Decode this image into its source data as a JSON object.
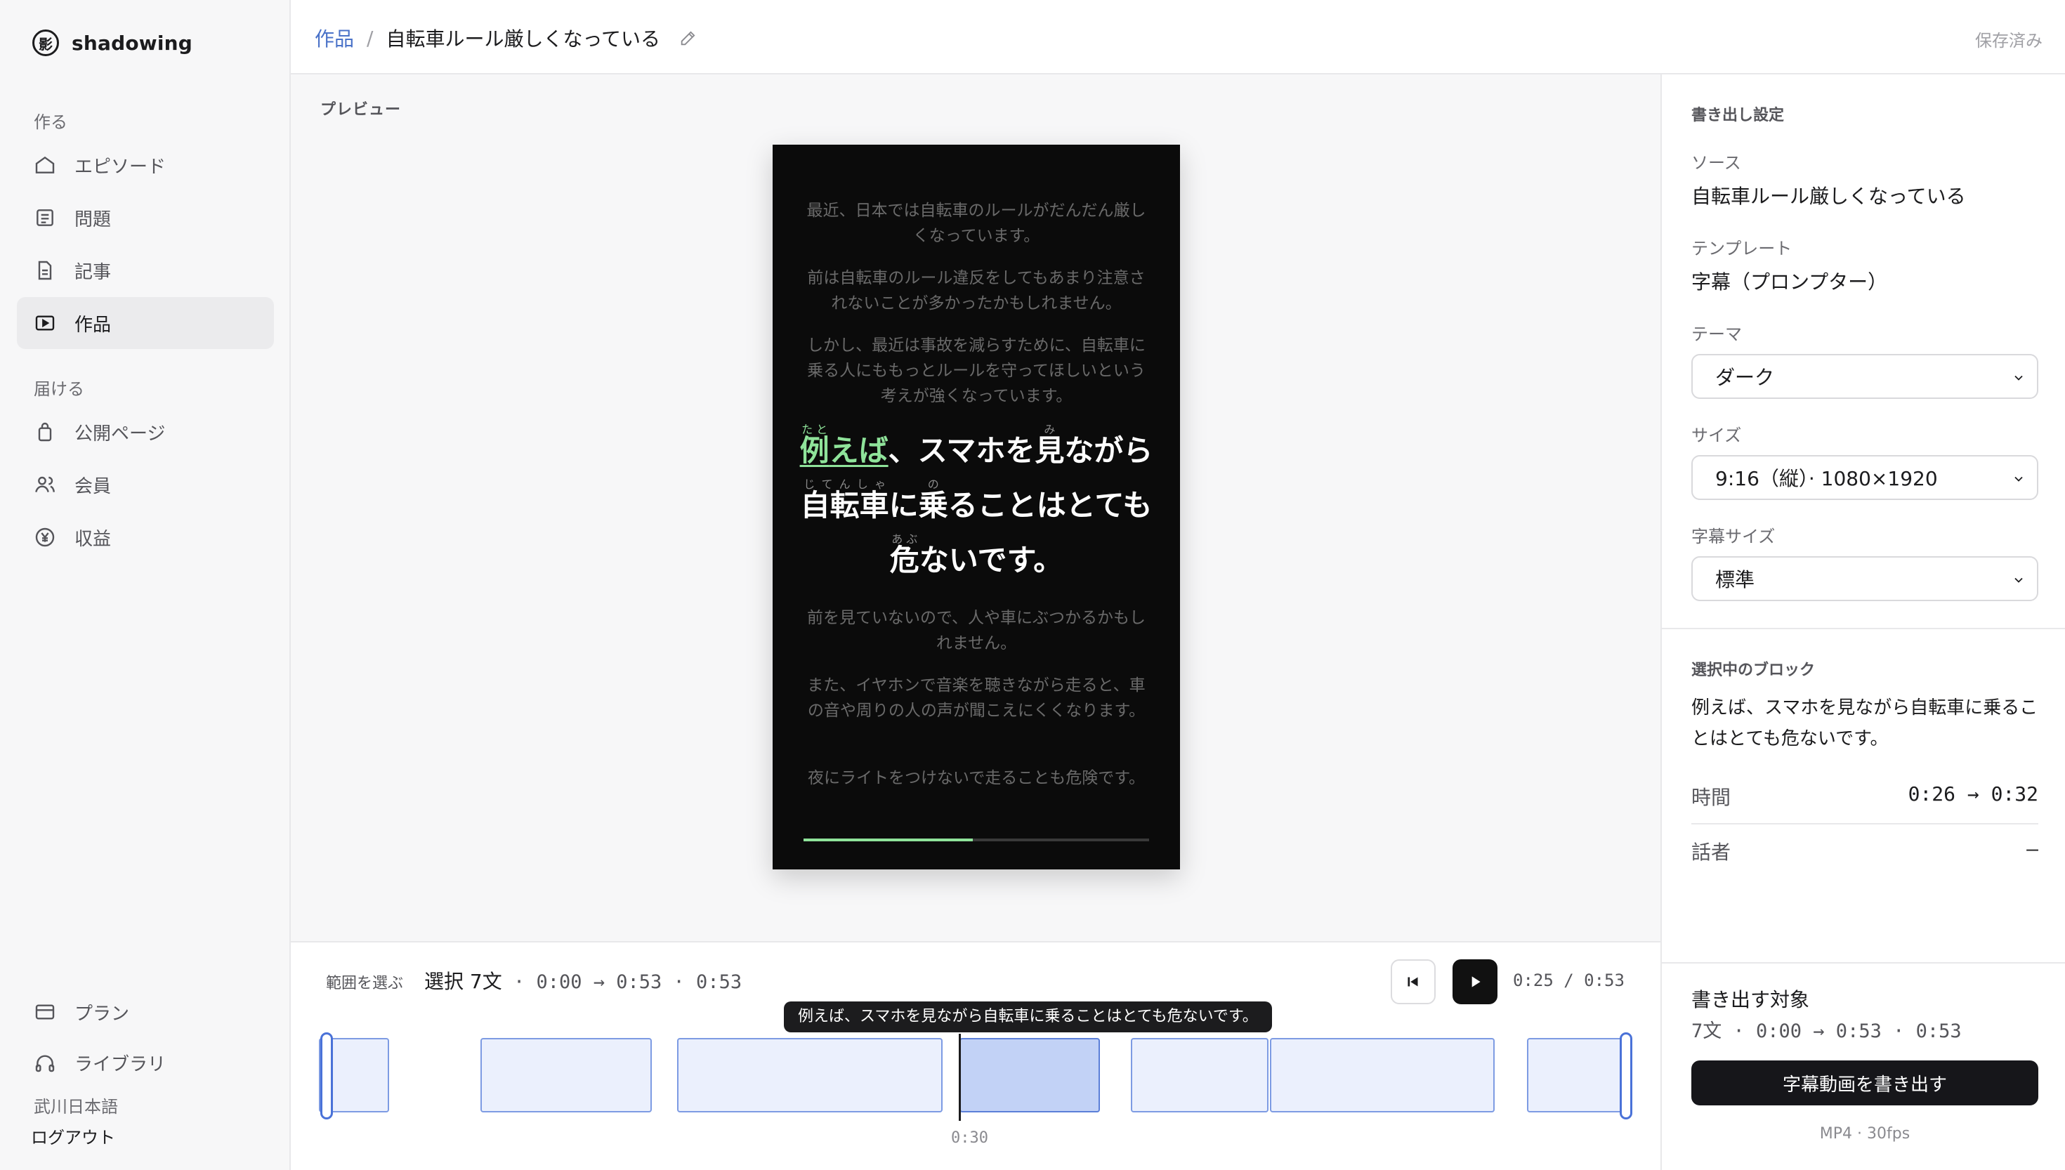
{
  "app": {
    "name": "shadowing",
    "logo_char": "影"
  },
  "sidebar": {
    "section_create": "作る",
    "section_deliver": "届ける",
    "items": [
      {
        "label": "エピソード",
        "icon": "home-icon"
      },
      {
        "label": "問題",
        "icon": "list-icon"
      },
      {
        "label": "記事",
        "icon": "document-icon"
      },
      {
        "label": "作品",
        "icon": "video-icon",
        "active": true
      },
      {
        "label": "公開ページ",
        "icon": "bag-icon"
      },
      {
        "label": "会員",
        "icon": "users-icon"
      },
      {
        "label": "収益",
        "icon": "yen-icon"
      }
    ],
    "bottom_items": [
      {
        "label": "プラン",
        "icon": "card-icon"
      },
      {
        "label": "ライブラリ",
        "icon": "headphones-icon"
      }
    ],
    "user_name": "武川日本語",
    "logout_label": "ログアウト"
  },
  "header": {
    "crumb_parent": "作品",
    "crumb_sep": "/",
    "title": "自転車ルール厳しくなっている",
    "status": "保存済み"
  },
  "preview": {
    "label": "プレビュー",
    "paragraphs_before": [
      "最近、日本では自転車のルールがだんだん厳しくなっています。",
      "前は自転車のルール違反をしてもあまり注意されないことが多かったかもしれません。",
      "しかし、最近は事故を減らすために、自転車に乗る人にももっとルールを守ってほしいという考えが強くなっています。"
    ],
    "current": {
      "hl_base": "例えば",
      "hl_ruby_base": "例",
      "hl_ruby": "たと",
      "hl_rest": "えば",
      "part1": "、スマホを",
      "ruby_mi_base": "見",
      "ruby_mi": "み",
      "part2": "ながら",
      "ruby_jitensha_base": "自転車",
      "ruby_jitensha": "じてんしゃ",
      "part3": "に",
      "ruby_no_base": "乗",
      "ruby_no": "の",
      "part4": "ることはとても",
      "ruby_abu_base": "危",
      "ruby_abu": "あぶ",
      "part5": "ないです。"
    },
    "paragraphs_after": [
      "前を見ていないので、人や車にぶつかるかもしれません。",
      "また、イヤホンで音楽を聴きながら走ると、車の音や周りの人の声が聞こえにくくなります。",
      "夜にライトをつけないで走ることも危険です。"
    ],
    "progress": 0.49
  },
  "timeline": {
    "range_label": "範囲を選ぶ",
    "selection_prefix": "選択 7文",
    "selection_times": " · 0:00 → 0:53 · 0:53",
    "current_time": "0:25 / 0:53",
    "tooltip": "例えば、スマホを見ながら自転車に乗ることはとても危ないです。",
    "tick_label": "0:30",
    "prev_icon": "skip-back-icon",
    "play_icon": "play-icon"
  },
  "panel": {
    "export_heading": "書き出し設定",
    "source_label": "ソース",
    "source_value": "自転車ルール厳しくなっている",
    "template_label": "テンプレート",
    "template_value": "字幕（プロンプター）",
    "theme_label": "テーマ",
    "theme_value": "ダーク",
    "size_label": "サイズ",
    "size_value": "9:16（縦）· 1080×1920",
    "caption_size_label": "字幕サイズ",
    "caption_size_value": "標準",
    "selected_block_heading": "選択中のブロック",
    "selected_block_text": "例えば、スマホを見ながら自転車に乗ることはとても危ないです。",
    "time_label": "時間",
    "time_value": "0:26 → 0:32",
    "speaker_label": "話者",
    "speaker_value": "—",
    "target_heading": "書き出す対象",
    "target_value": "7文 · 0:00 → 0:53 · 0:53",
    "export_button": "字幕動画を書き出す",
    "export_note": "MP4 · 30fps"
  },
  "colors": {
    "accent": "#4a72c8",
    "highlight": "#8fe39a",
    "block": "#ebf0fd",
    "block_selected": "#c2d2f6"
  }
}
